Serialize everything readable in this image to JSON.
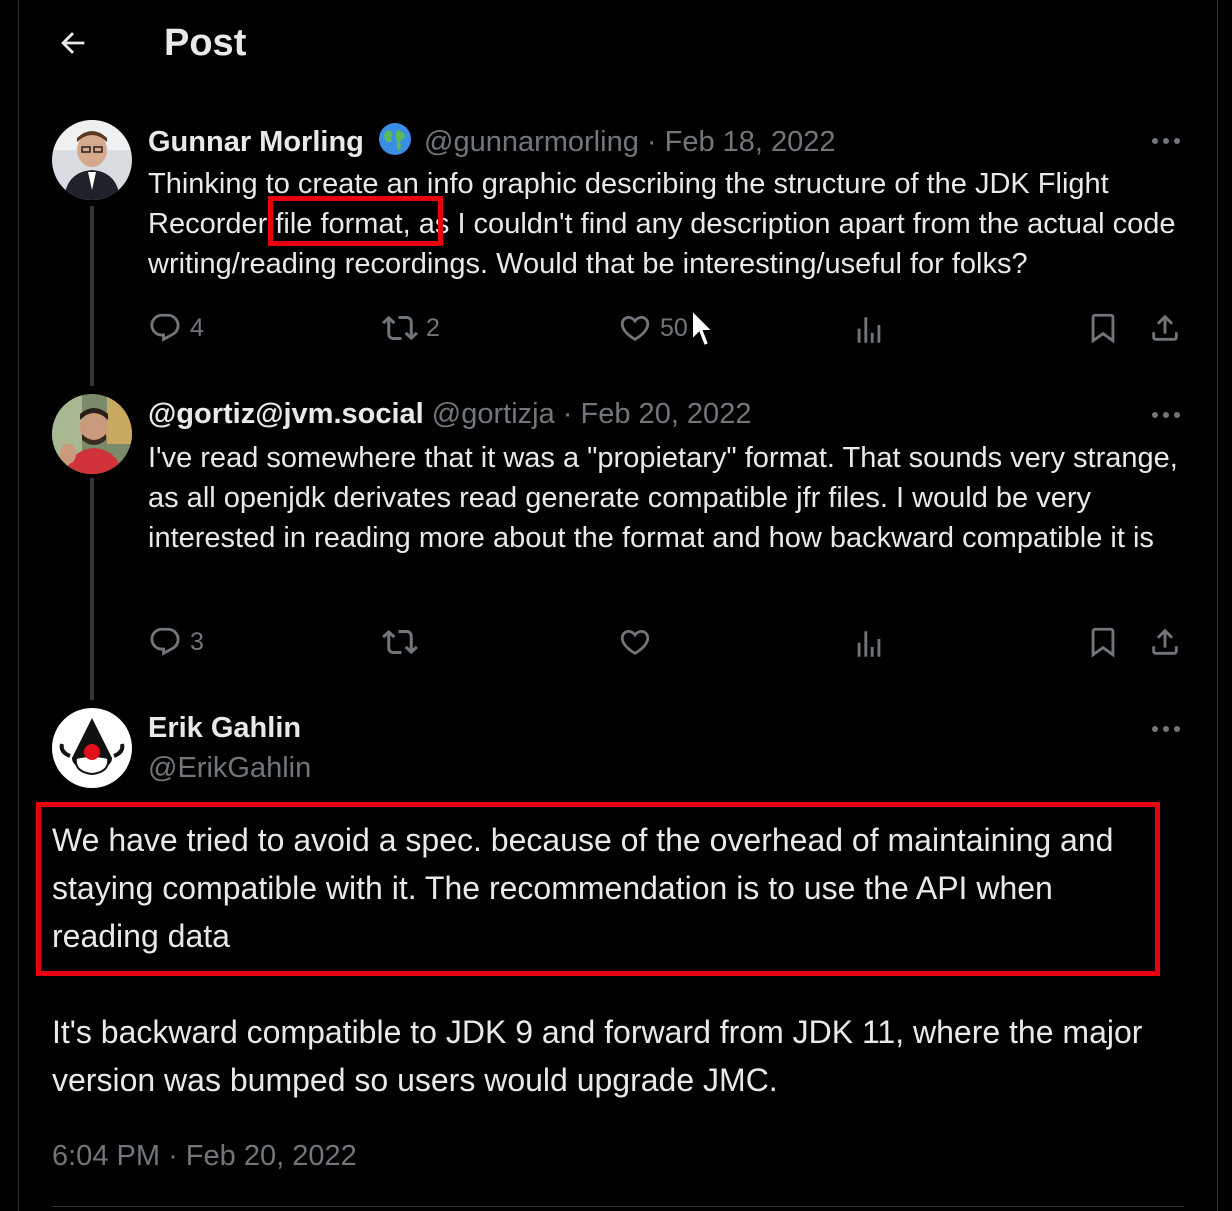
{
  "header": {
    "title": "Post"
  },
  "tweets": [
    {
      "name": "Gunnar Morling",
      "badge_icon": "globe-icon",
      "handle": "@gunnarmorling",
      "date": "Feb 18, 2022",
      "text_before": "Thinking to create an info graphic describing the structure of the JDK Flight Recorder ",
      "text_highlight": "file format,",
      "text_after": " as I couldn't find any description apart from the actual code writing/reading recordings. Would that be interesting/useful for folks?",
      "replies": "4",
      "reposts": "2",
      "likes": "50",
      "views": ""
    },
    {
      "name": "@gortiz@jvm.social",
      "handle": "@gortizja",
      "date": "Feb 20, 2022",
      "text": "I've read somewhere that it was a \"propietary\" format. That sounds very strange, as all openjdk derivates read generate compatible jfr files. I would be very interested in reading more about the format and how backward compatible it is",
      "replies": "3",
      "reposts": "",
      "likes": "",
      "views": ""
    }
  ],
  "main_post": {
    "name": "Erik Gahlin",
    "handle": "@ErikGahlin",
    "paragraph_1": "We have tried to avoid a spec. because of the overhead of maintaining and staying compatible with it. The recommendation is to use the API when reading data",
    "paragraph_2": "It's backward compatible to JDK 9 and forward from JDK 11, where the major version was bumped so users would upgrade JMC.",
    "time": "6:04 PM",
    "date": "Feb 20, 2022"
  },
  "colors": {
    "background": "#000000",
    "text": "#e7e9ea",
    "muted": "#71767b",
    "highlight": "#e8000e"
  }
}
